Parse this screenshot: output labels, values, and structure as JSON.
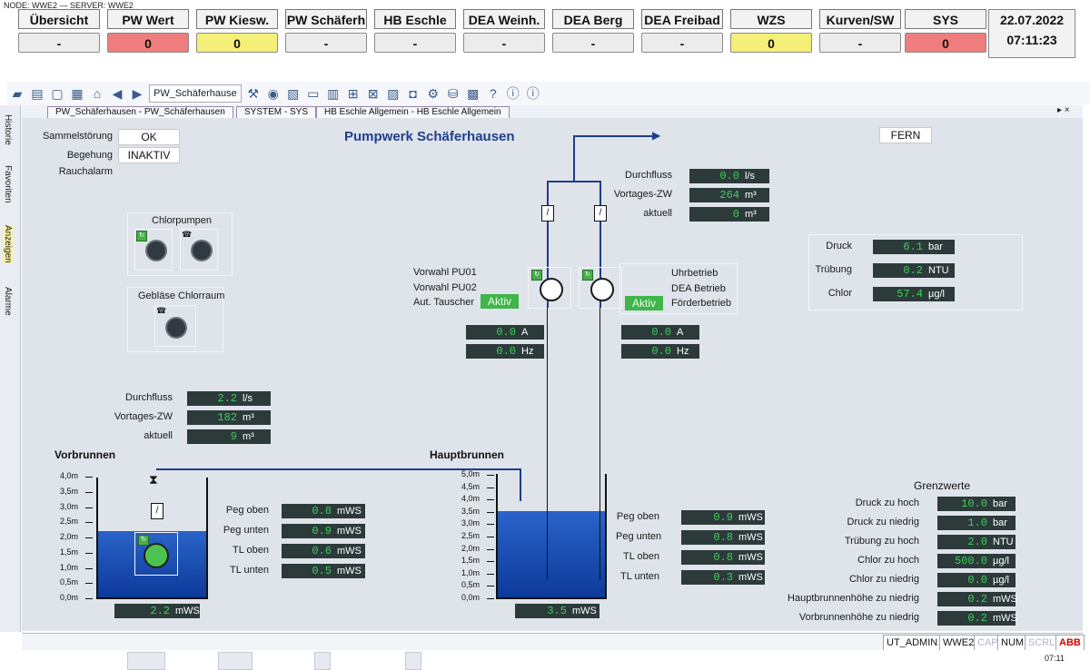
{
  "node_line": "NODE: WWE2 — SERVER: WWE2",
  "header": [
    {
      "title": "Übersicht",
      "value": "-",
      "state": "normal"
    },
    {
      "title": "PW Wert",
      "value": "0",
      "state": "red"
    },
    {
      "title": "PW Kiesw.",
      "value": "0",
      "state": "yellow"
    },
    {
      "title": "PW Schäferh",
      "value": "-",
      "state": "normal"
    },
    {
      "title": "HB Eschle",
      "value": "-",
      "state": "normal"
    },
    {
      "title": "DEA Weinh.",
      "value": "-",
      "state": "normal"
    },
    {
      "title": "DEA Berg",
      "value": "-",
      "state": "normal"
    },
    {
      "title": "DEA Freibad",
      "value": "-",
      "state": "normal"
    },
    {
      "title": "WZS",
      "value": "0",
      "state": "yellow"
    },
    {
      "title": "Kurven/SW",
      "value": "-",
      "state": "normal"
    },
    {
      "title": "SYS",
      "value": "0",
      "state": "red"
    }
  ],
  "datetime": {
    "date": "22.07.2022",
    "time": "07:11:23"
  },
  "toolbar": {
    "picture_field": "PW_Schäferhause"
  },
  "tabs": [
    "PW_Schäferhausen - PW_Schäferhausen",
    "SYSTEM - SYS",
    "HB Eschle Allgemein - HB Eschle Allgemein"
  ],
  "tab_controls": "▸ ×",
  "sidebar": [
    "Historie",
    "Favoriten",
    "Anzeigen",
    "Alarme"
  ],
  "colors": {
    "accent_blue": "#1f3f8c",
    "value_green": "#3cd05a",
    "value_bg": "#2c3a3a",
    "aktiv_green": "#3fb54a",
    "alarm_red": "#f07d7d",
    "warn_yellow": "#f3ef78"
  },
  "screen": {
    "title": "Pumpwerk Schäferhausen",
    "status": [
      {
        "label": "Sammelstörung",
        "value": "OK"
      },
      {
        "label": "Begehung",
        "value": "INAKTIV"
      },
      {
        "label": "Rauchalarm",
        "value": ""
      }
    ],
    "fern": "FERN",
    "chlorpumpen": "Chlorpumpen",
    "geblaese": "Gebläse Chlorraum",
    "left_flow": [
      {
        "label": "Durchfluss",
        "value": "2.2",
        "unit": "l/s"
      },
      {
        "label": "Vortages-ZW",
        "value": "182",
        "unit": "m³"
      },
      {
        "label": "aktuell",
        "value": "9",
        "unit": "m³"
      }
    ],
    "top_flow": [
      {
        "label": "Durchfluss",
        "value": "0.0",
        "unit": "l/s"
      },
      {
        "label": "Vortages-ZW",
        "value": "264",
        "unit": "m³"
      },
      {
        "label": "aktuell",
        "value": "0",
        "unit": "m³"
      }
    ],
    "pumps_left_labels": [
      "Vorwahl PU01",
      "Vorwahl PU02",
      "Aut. Tauscher"
    ],
    "aktiv": "Aktiv",
    "pumps_right_labels": [
      "Uhrbetrieb",
      "DEA Betrieb",
      "Förderbetrieb"
    ],
    "pump1": [
      {
        "value": "0.0",
        "unit": "A"
      },
      {
        "value": "0.0",
        "unit": "Hz"
      }
    ],
    "pump2": [
      {
        "value": "0.0",
        "unit": "A"
      },
      {
        "value": "0.0",
        "unit": "Hz"
      }
    ],
    "quality": [
      {
        "label": "Druck",
        "value": "6.1",
        "unit": "bar"
      },
      {
        "label": "Trübung",
        "value": "0.2",
        "unit": "NTU"
      },
      {
        "label": "Chlor",
        "value": "57.4",
        "unit": "µg/l"
      }
    ],
    "vorbrunnen": {
      "title": "Vorbrunnen",
      "scale": [
        "4,0m",
        "3,5m",
        "3,0m",
        "2,5m",
        "2,0m",
        "1,5m",
        "1,0m",
        "0,5m",
        "0,0m"
      ],
      "level": {
        "value": "2.2",
        "unit": "mWS"
      },
      "fill_fraction": 0.55,
      "readings": [
        {
          "label": "Peg oben",
          "value": "0.8",
          "unit": "mWS"
        },
        {
          "label": "Peg unten",
          "value": "0.9",
          "unit": "mWS"
        },
        {
          "label": "TL oben",
          "value": "0.6",
          "unit": "mWS"
        },
        {
          "label": "TL unten",
          "value": "0.5",
          "unit": "mWS"
        }
      ]
    },
    "hauptbrunnen": {
      "title": "Hauptbrunnen",
      "scale": [
        "5,0m",
        "4,5m",
        "4,0m",
        "3,5m",
        "3,0m",
        "2,5m",
        "2,0m",
        "1,5m",
        "1,0m",
        "0,5m",
        "0,0m"
      ],
      "level": {
        "value": "3.5",
        "unit": "mWS"
      },
      "fill_fraction": 0.7,
      "readings": [
        {
          "label": "Peg oben",
          "value": "0.9",
          "unit": "mWS"
        },
        {
          "label": "Peg unten",
          "value": "0.8",
          "unit": "mWS"
        },
        {
          "label": "TL oben",
          "value": "0.8",
          "unit": "mWS"
        },
        {
          "label": "TL unten",
          "value": "0.3",
          "unit": "mWS"
        }
      ]
    },
    "grenzwerte": {
      "title": "Grenzwerte",
      "rows": [
        {
          "label": "Druck zu hoch",
          "value": "10.0",
          "unit": "bar"
        },
        {
          "label": "Druck zu niedrig",
          "value": "1.0",
          "unit": "bar"
        },
        {
          "label": "Trübung zu hoch",
          "value": "2.0",
          "unit": "NTU"
        },
        {
          "label": "Chlor zu hoch",
          "value": "500.0",
          "unit": "µg/l"
        },
        {
          "label": "Chlor zu niedrig",
          "value": "0.0",
          "unit": "µg/l"
        },
        {
          "label": "Hauptbrunnenhöhe zu niedrig",
          "value": "0.2",
          "unit": "mWS"
        },
        {
          "label": "Vorbrunnenhöhe zu niedrig",
          "value": "0.2",
          "unit": "mWS"
        }
      ]
    }
  },
  "statusbar": [
    "UT_ADMIN",
    "WWE2",
    "CAP",
    "NUM",
    "SCRL",
    "ABB"
  ],
  "taskbar_time": "07:11"
}
